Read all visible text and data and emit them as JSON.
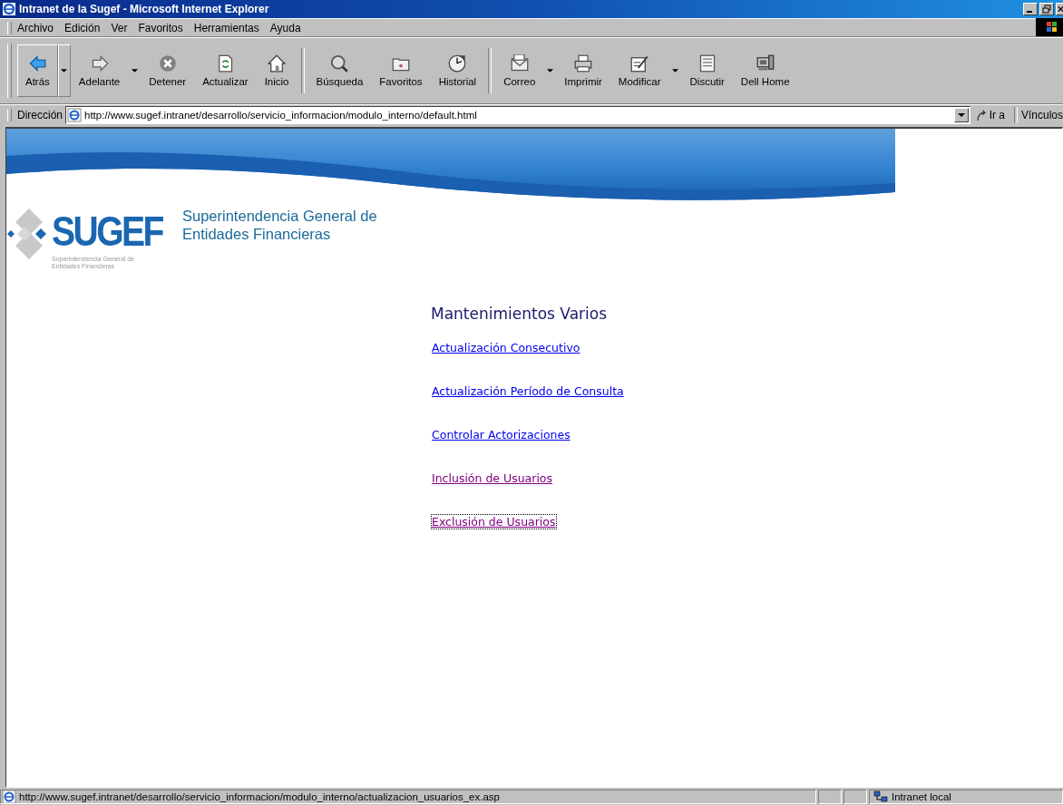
{
  "window": {
    "title": "Intranet de la Sugef - Microsoft Internet Explorer"
  },
  "menu": [
    {
      "label": "Archivo"
    },
    {
      "label": "Edición"
    },
    {
      "label": "Ver"
    },
    {
      "label": "Favoritos"
    },
    {
      "label": "Herramientas"
    },
    {
      "label": "Ayuda"
    }
  ],
  "toolbar": {
    "groups": [
      [
        {
          "label": "Atrás",
          "dropdown": true,
          "disabled": false
        },
        {
          "label": "Adelante",
          "dropdown": true,
          "disabled": false
        },
        {
          "label": "Detener",
          "dropdown": false,
          "disabled": false
        },
        {
          "label": "Actualizar",
          "dropdown": false,
          "disabled": false
        },
        {
          "label": "Inicio",
          "dropdown": false,
          "disabled": false
        }
      ],
      [
        {
          "label": "Búsqueda",
          "dropdown": false,
          "disabled": false
        },
        {
          "label": "Favoritos",
          "dropdown": false,
          "disabled": false
        },
        {
          "label": "Historial",
          "dropdown": false,
          "disabled": false
        }
      ],
      [
        {
          "label": "Correo",
          "dropdown": true,
          "disabled": false
        },
        {
          "label": "Imprimir",
          "dropdown": false,
          "disabled": false
        },
        {
          "label": "Modificar",
          "dropdown": true,
          "disabled": false
        },
        {
          "label": "Discutir",
          "dropdown": false,
          "disabled": false
        },
        {
          "label": "Dell Home",
          "dropdown": false,
          "disabled": false
        }
      ]
    ]
  },
  "address_bar": {
    "label": "Dirección",
    "value": "http://www.sugef.intranet/desarrollo/servicio_informacion/modulo_interno/default.html",
    "go_button": "Ir a",
    "links_label": "Vínculos"
  },
  "page": {
    "logo": {
      "wordmark": "SUGEF",
      "subtitle": "Superintendencia General de Entidades Financieras"
    },
    "header_title": "Superintendencia General de Entidades Financieras",
    "section_title": "Mantenimientos Varios",
    "links": [
      {
        "label": "Actualización Consecutivo",
        "visited": false,
        "focused": false
      },
      {
        "label": "Actualización Período de Consulta",
        "visited": false,
        "focused": false
      },
      {
        "label": "Controlar Actorizaciones",
        "visited": false,
        "focused": false
      },
      {
        "label": "Inclusión de Usuarios",
        "visited": true,
        "focused": false
      },
      {
        "label": "Exclusión de Usuarios",
        "visited": true,
        "focused": true
      }
    ]
  },
  "status_bar": {
    "text": "http://www.sugef.intranet/desarrollo/servicio_informacion/modulo_interno/actualizacion_usuarios_ex.asp",
    "zone": "Intranet local"
  }
}
